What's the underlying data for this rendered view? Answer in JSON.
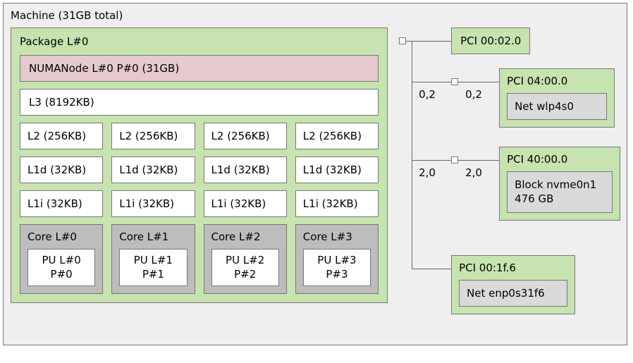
{
  "machine": {
    "title": "Machine (31GB total)"
  },
  "package": {
    "title": "Package L#0"
  },
  "numanode": {
    "title": "NUMANode L#0 P#0 (31GB)"
  },
  "l3": {
    "title": "L3 (8192KB)"
  },
  "l2": [
    "L2 (256KB)",
    "L2 (256KB)",
    "L2 (256KB)",
    "L2 (256KB)"
  ],
  "l1d": [
    "L1d (32KB)",
    "L1d (32KB)",
    "L1d (32KB)",
    "L1d (32KB)"
  ],
  "l1i": [
    "L1i (32KB)",
    "L1i (32KB)",
    "L1i (32KB)",
    "L1i (32KB)"
  ],
  "cores": [
    {
      "title": "Core L#0",
      "pu": "PU L#0\nP#0"
    },
    {
      "title": "Core L#1",
      "pu": "PU L#1\nP#1"
    },
    {
      "title": "Core L#2",
      "pu": "PU L#2\nP#2"
    },
    {
      "title": "Core L#3",
      "pu": "PU L#3\nP#3"
    }
  ],
  "pci": {
    "bridges": [
      {
        "label1": "0,2",
        "label2": "0,2"
      },
      {
        "label1": "2,0",
        "label2": "2,0"
      }
    ],
    "devices": [
      {
        "title": "PCI 00:02.0",
        "child": null
      },
      {
        "title": "PCI 04:00.0",
        "child": "Net wlp4s0"
      },
      {
        "title": "PCI 40:00.0",
        "child": "Block nvme0n1\n476 GB"
      },
      {
        "title": "PCI 00:1f.6",
        "child": "Net enp0s31f6"
      }
    ]
  }
}
